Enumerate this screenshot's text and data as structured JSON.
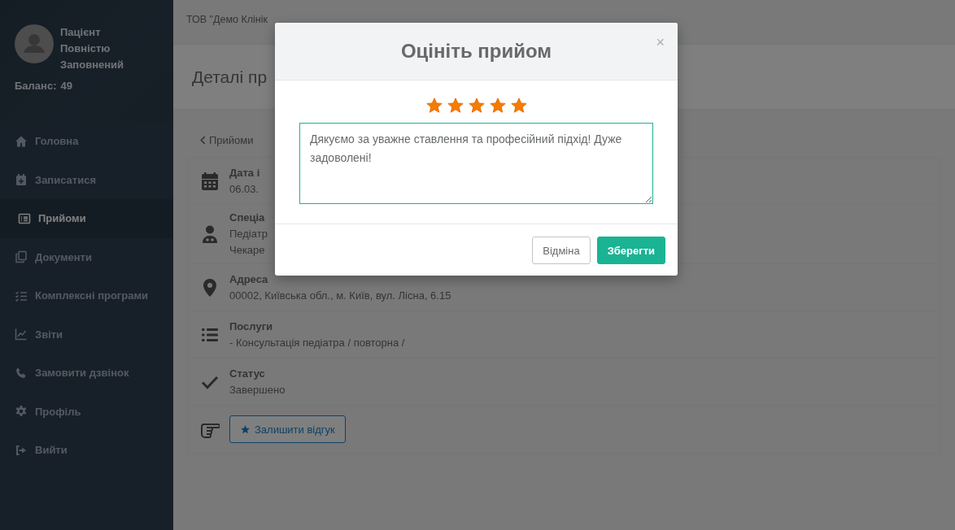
{
  "top_bar": {
    "company": "ТОВ \"Демо Клінік"
  },
  "sidebar": {
    "profile": {
      "name_lines": [
        "Пацієнт",
        "Повністю",
        "Заповнений"
      ],
      "balance_label": "Баланс:",
      "balance": "49"
    },
    "items": [
      {
        "label": "Головна",
        "selected": false
      },
      {
        "label": "Записатися",
        "selected": false
      },
      {
        "label": "Прийоми",
        "selected": true
      },
      {
        "label": "Документи",
        "selected": false
      },
      {
        "label": "Комплексні програми",
        "selected": false
      },
      {
        "label": "Звіти",
        "selected": false
      },
      {
        "label": "Замовити дзвінок",
        "selected": false
      },
      {
        "label": "Профіль",
        "selected": false
      },
      {
        "label": "Вийти",
        "selected": false
      }
    ]
  },
  "page": {
    "title": "Деталі пр",
    "back_link": "Прийоми",
    "rows": [
      {
        "kind": "info",
        "label": "Дата і",
        "lines": [
          "06.03."
        ]
      },
      {
        "kind": "info",
        "label": "Спеціа",
        "lines": [
          "Педіатр",
          "Чекаре"
        ]
      },
      {
        "kind": "info",
        "label": "Адреса",
        "lines": [
          "00002, Київська обл., м. Київ, вул. Лісна, 6.15"
        ]
      },
      {
        "kind": "info",
        "label": "Послуги",
        "lines": [
          "- Консультація педіатра / повторна /"
        ]
      },
      {
        "kind": "info",
        "label": "Статус",
        "lines": [
          "Завершено"
        ]
      },
      {
        "kind": "action",
        "button": "Залишити відгук"
      }
    ]
  },
  "modal": {
    "title": "Оцініть прийом",
    "close": "×",
    "stars": 5,
    "comment": "Дякуємо за уважне ставлення та професійний підхід! Дуже задоволені!",
    "buttons": [
      {
        "label": "Відміна",
        "kind": "default"
      },
      {
        "label": "Зберегти",
        "kind": "primary"
      }
    ]
  }
}
